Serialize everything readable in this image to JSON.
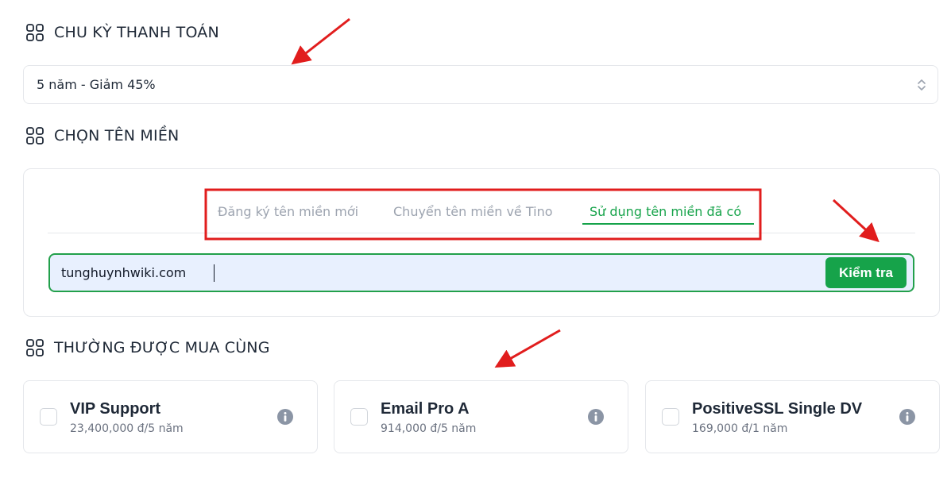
{
  "billing": {
    "title": "CHU KỲ THANH TOÁN",
    "selected": "5 năm - Giảm 45%"
  },
  "domain": {
    "title": "CHỌN TÊN MIỀN",
    "tabs": [
      {
        "label": "Đăng ký tên miền mới",
        "active": false
      },
      {
        "label": "Chuyển tên miền về Tino",
        "active": false
      },
      {
        "label": "Sử dụng tên miền đã có",
        "active": true
      }
    ],
    "input_value": "tunghuynhwiki.com",
    "check_button": "Kiểm tra"
  },
  "addons": {
    "title": "THƯỜNG ĐƯỢC MUA CÙNG",
    "items": [
      {
        "name": "VIP Support",
        "price": "23,400,000 đ/5 năm"
      },
      {
        "name": "Email Pro A",
        "price": "914,000 đ/5 năm"
      },
      {
        "name": "PositiveSSL Single DV",
        "price": "169,000 đ/1 năm"
      }
    ]
  },
  "colors": {
    "accent": "#16a34a",
    "annotation": "#e11d1d",
    "input_bg": "#e8f0fe"
  },
  "icons": [
    "grid-icon",
    "select-arrows-icon",
    "info-icon",
    "checkbox-icon",
    "arrow-annotation"
  ]
}
